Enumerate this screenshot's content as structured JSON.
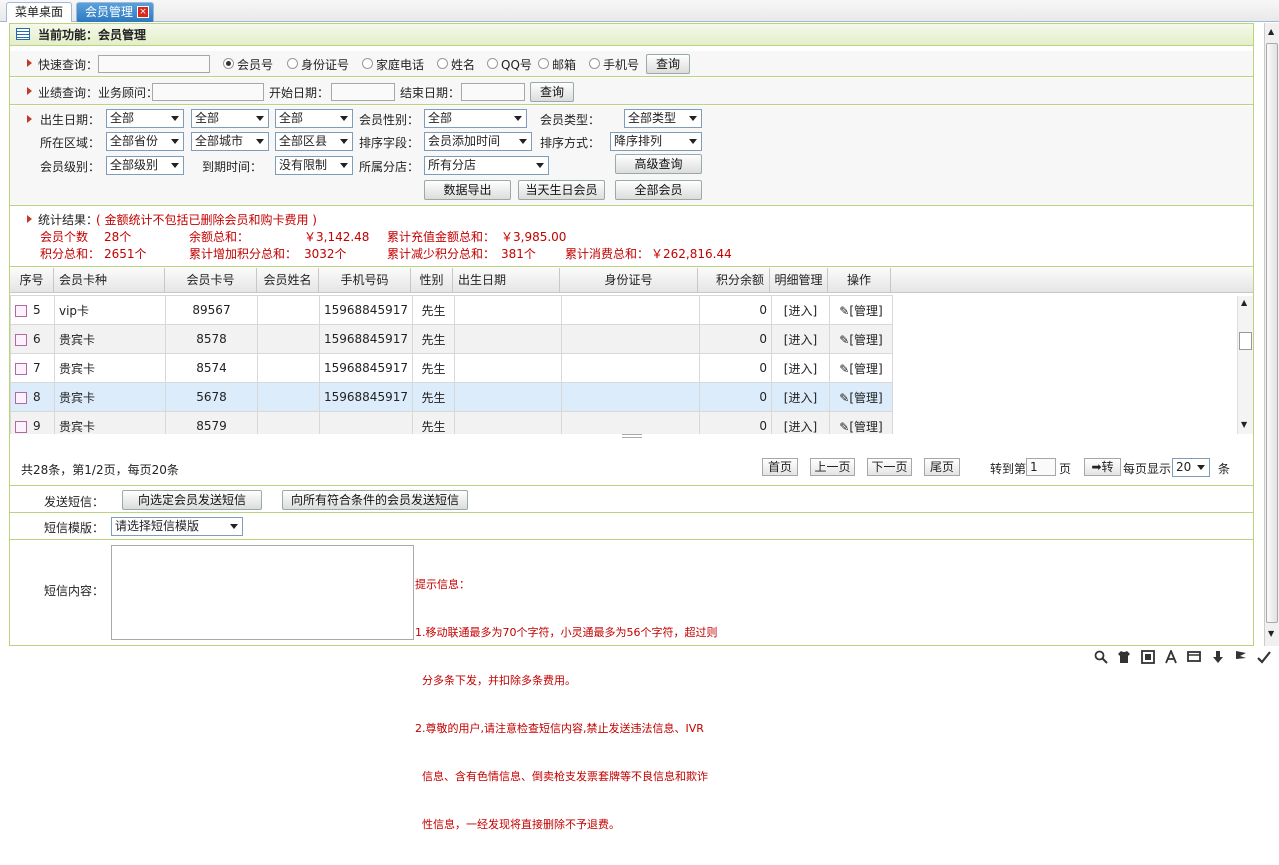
{
  "tabs": [
    {
      "label": "菜单桌面"
    },
    {
      "label": "会员管理",
      "close": "×"
    }
  ],
  "header": {
    "title": "当前功能：会员管理"
  },
  "quick_search": {
    "label": "快速查询：",
    "value": "",
    "options": [
      "会员号",
      "身份证号",
      "家庭电话",
      "姓名",
      "QQ号",
      "邮箱",
      "手机号"
    ],
    "selected": "会员号",
    "button": "查询"
  },
  "perf_search": {
    "label": "业绩查询：业务顾问：",
    "start_label": "开始日期：",
    "end_label": "结束日期：",
    "button": "查询"
  },
  "filters": {
    "birth_label": "出生日期：",
    "birth_values": [
      "全部",
      "全部",
      "全部"
    ],
    "gender_label": "会员性别：",
    "gender_value": "全部",
    "type_label": "会员类型：",
    "type_value": "全部类型",
    "region_label": "所在区域：",
    "region_values": [
      "全部省份",
      "全部城市",
      "全部区县"
    ],
    "sort_label": "排序字段：",
    "sort_value": "会员添加时间",
    "order_label": "排序方式：",
    "order_value": "降序排列",
    "level_label": "会员级别：",
    "level_value": "全部级别",
    "expire_label": "到期时间：",
    "expire_value": "没有限制",
    "branch_label": "所属分店：",
    "branch_value": "所有分店",
    "advanced_button": "高级查询",
    "export_button": "数据导出",
    "birthday_button": "当天生日会员",
    "all_button": "全部会员"
  },
  "stats": {
    "title": "统计结果：",
    "note": "( 金额统计不包括已删除会员和购卡费用 )",
    "items": [
      {
        "label": "会员个数",
        "value": "28个"
      },
      {
        "label": "余额总和：",
        "value": "￥3,142.48"
      },
      {
        "label": "累计充值金额总和：",
        "value": "￥3,985.00"
      },
      {
        "label": "积分总和：",
        "value": "2651个"
      },
      {
        "label": "累计增加积分总和：",
        "value": "3032个"
      },
      {
        "label": "累计减少积分总和：",
        "value": "381个"
      },
      {
        "label": "累计消费总和：",
        "value": "￥262,816.44"
      }
    ]
  },
  "table": {
    "headers": [
      "序号",
      "会员卡种",
      "会员卡号",
      "会员姓名",
      "手机号码",
      "性别",
      "出生日期",
      "身份证号",
      "积分余额",
      "明细管理",
      "操作"
    ],
    "rows": [
      {
        "no": "5",
        "kind": "vip卡",
        "card": "89567",
        "name": "",
        "phone": "15968845917",
        "sex": "先生",
        "birth": "",
        "id": "",
        "points": "0",
        "detail": "[进入]",
        "op": "[管理]"
      },
      {
        "no": "6",
        "kind": "贵宾卡",
        "card": "8578",
        "name": "",
        "phone": "15968845917",
        "sex": "先生",
        "birth": "",
        "id": "",
        "points": "0",
        "detail": "[进入]",
        "op": "[管理]"
      },
      {
        "no": "7",
        "kind": "贵宾卡",
        "card": "8574",
        "name": "",
        "phone": "15968845917",
        "sex": "先生",
        "birth": "",
        "id": "",
        "points": "0",
        "detail": "[进入]",
        "op": "[管理]"
      },
      {
        "no": "8",
        "kind": "贵宾卡",
        "card": "5678",
        "name": "",
        "phone": "15968845917",
        "sex": "先生",
        "birth": "",
        "id": "",
        "points": "0",
        "detail": "[进入]",
        "op": "[管理]"
      },
      {
        "no": "9",
        "kind": "贵宾卡",
        "card": "8579",
        "name": "",
        "phone": "",
        "sex": "先生",
        "birth": "",
        "id": "",
        "points": "0",
        "detail": "[进入]",
        "op": "[管理]"
      }
    ],
    "highlight_color": "#dcecfb"
  },
  "pager": {
    "summary": "共28条，第1/2页，每页20条",
    "first": "首页",
    "prev": "上一页",
    "next": "下一页",
    "last": "尾页",
    "goto_label": "转到第",
    "goto_value": "1",
    "page_unit": "页",
    "go_button": "➡转",
    "per_page_label": "每页显示",
    "per_page_value": "20",
    "count_unit": "条"
  },
  "sms": {
    "send_label": "发送短信：",
    "send_selected": "向选定会员发送短信",
    "send_all": "向所有符合条件的会员发送短信",
    "template_label": "短信模版：",
    "template_value": "请选择短信模版",
    "content_label": "短信内容：",
    "content_value": "",
    "tips_title": "提示信息：",
    "tips": [
      "1.移动联通最多为70个字符，小灵通最多为56个字符，超过则",
      "  分多条下发，并扣除多条费用。",
      "2.尊敬的用户,请注意检查短信内容,禁止发送违法信息、IVR",
      "  信息、含有色情信息、倒卖枪支发票套牌等不良信息和欺诈",
      "  性信息，一经发现将直接删除不予退费。"
    ]
  },
  "colors": {
    "accent_green": "#b9d37e",
    "tab_blue": "#2d79c1",
    "alert_red": "#c40000"
  }
}
